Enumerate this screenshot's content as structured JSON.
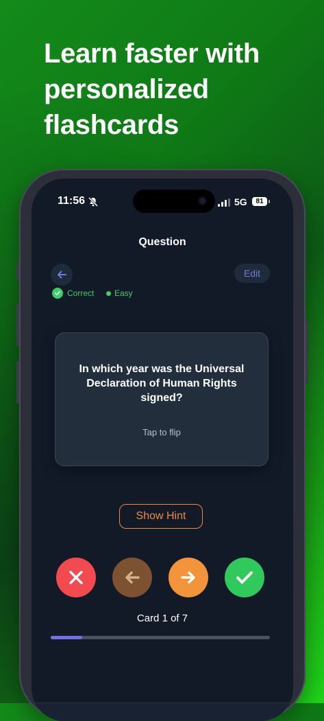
{
  "headline": "Learn faster with personalized flashcards",
  "status_bar": {
    "time": "11:56",
    "network": "5G",
    "battery": "81"
  },
  "screen": {
    "title": "Question",
    "edit_label": "Edit",
    "badges": {
      "correct": "Correct",
      "difficulty": "Easy"
    },
    "card": {
      "question": "In which year was the Universal Declaration of Human Rights signed?",
      "flip_hint": "Tap to flip"
    },
    "hint_label": "Show Hint",
    "counter": "Card 1 of 7",
    "progress": {
      "current": 1,
      "total": 7
    }
  },
  "colors": {
    "accent": "#6e72e2",
    "correct": "#3ccf6a",
    "wrong": "#f14b4f",
    "previous": "#7d5231",
    "next": "#f3933a",
    "hint": "#f08a3c"
  },
  "icons": [
    "bell-slash-icon",
    "signal-icon",
    "arrow-left-icon",
    "check-icon",
    "close-icon",
    "arrow-right-icon"
  ]
}
